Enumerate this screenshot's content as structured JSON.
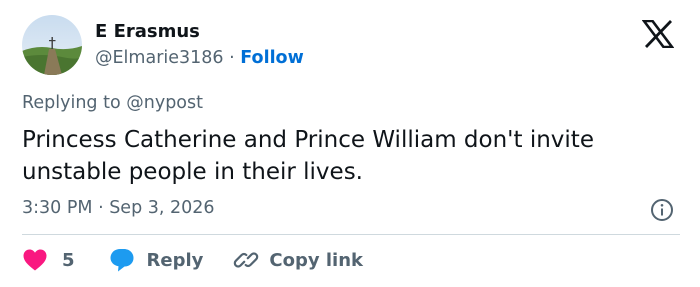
{
  "author": {
    "name": "E Erasmus",
    "handle": "@Elmarie3186",
    "separator": "·",
    "follow_label": "Follow"
  },
  "reply_context": {
    "prefix": "Replying to",
    "mention": "@nypost"
  },
  "tweet": {
    "text": "Princess Catherine and Prince William don't invite unstable people in their lives.",
    "timestamp": "3:30 PM · Sep 3, 2026"
  },
  "actions": {
    "like_count": "5",
    "reply_label": "Reply",
    "copy_link_label": "Copy link"
  },
  "colors": {
    "like": "#f91880",
    "reply": "#1d9bf0",
    "follow": "#006fd6",
    "secondary_text": "#536471"
  },
  "icons": [
    "x-logo-icon",
    "heart-icon",
    "reply-bubble-icon",
    "link-icon",
    "info-icon"
  ]
}
